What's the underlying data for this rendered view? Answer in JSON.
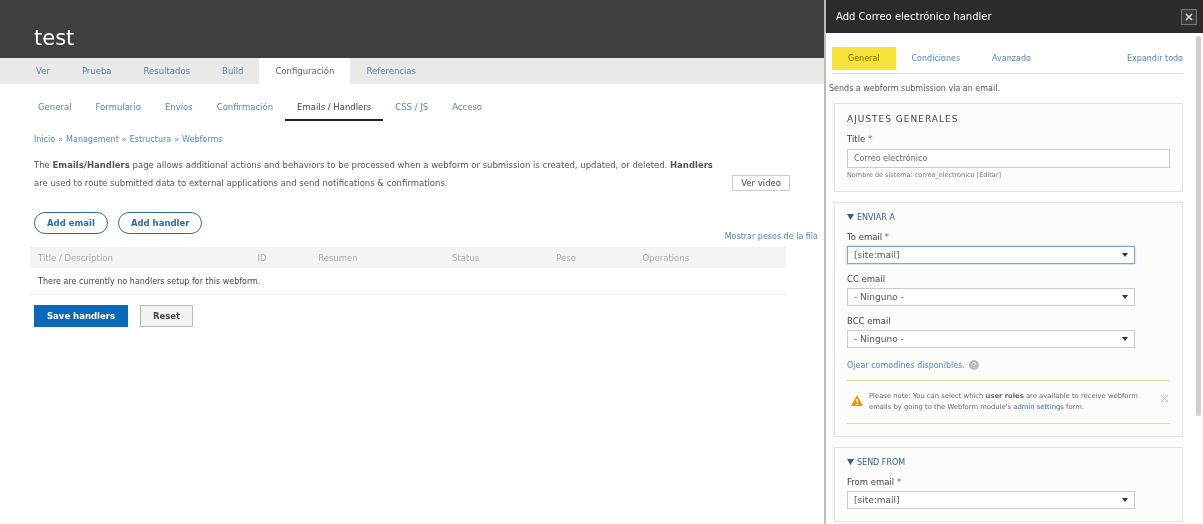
{
  "page": {
    "title": "test"
  },
  "primary_tabs": [
    {
      "label": "Ver",
      "selected": false
    },
    {
      "label": "Prueba",
      "selected": false
    },
    {
      "label": "Resultados",
      "selected": false
    },
    {
      "label": "Build",
      "selected": false
    },
    {
      "label": "Configuración",
      "selected": true
    },
    {
      "label": "Referencias",
      "selected": false
    }
  ],
  "secondary_tabs": [
    {
      "label": "General",
      "selected": false
    },
    {
      "label": "Formulario",
      "selected": false
    },
    {
      "label": "Envíos",
      "selected": false
    },
    {
      "label": "Confirmación",
      "selected": false
    },
    {
      "label": "Emails / Handlers",
      "selected": true
    },
    {
      "label": "CSS / JS",
      "selected": false
    },
    {
      "label": "Acceso",
      "selected": false
    }
  ],
  "breadcrumb": {
    "separator": "»",
    "items": [
      "Inicio",
      "Management",
      "Estructura",
      "Webforms"
    ]
  },
  "description": "The **Emails/Handlers** page allows additional actions and behaviors to be processed when a webform or submission is created, updated, or deleted. **Handlers** are used to route submitted data to external applications and send notifications & confirmations.",
  "video_button": "Ver video",
  "action_buttons": [
    "Add email",
    "Add handler"
  ],
  "weights_link": "Mostrar pesos de la fila",
  "table": {
    "columns": [
      "Title / Description",
      "ID",
      "Resumen",
      "Status",
      "Peso",
      "Operations"
    ],
    "empty_message": "There are currently no handlers setup for this webform."
  },
  "form_buttons": [
    {
      "label": "Save handlers",
      "kind": "primary"
    },
    {
      "label": "Reset",
      "kind": "secondary"
    }
  ],
  "dialog": {
    "title": "Add Correo electrónico handler",
    "tabs": [
      {
        "label": "General",
        "selected": true
      },
      {
        "label": "Condiciones",
        "selected": false
      },
      {
        "label": "Avanzado",
        "selected": false
      }
    ],
    "expand_link": "Expandir todo",
    "intro": "Sends a webform submission via an email.",
    "sections": [
      {
        "kind": "fieldset",
        "title": "AJUSTES GENERALES",
        "items": [
          {
            "kind": "text",
            "label": "Title",
            "required_mark": "*",
            "value": "Correo electrónico",
            "focused": false,
            "description": "Nombre de sistema: correo_electronico [Editar]"
          }
        ]
      },
      {
        "kind": "details",
        "title": "ENVIAR A",
        "expanded": true,
        "items": [
          {
            "kind": "select",
            "label": "To email",
            "required_mark": "*",
            "value": "[site:mail]",
            "focused": true
          },
          {
            "kind": "select",
            "label": "CC email",
            "value": "- Ninguno -",
            "focused": false
          },
          {
            "kind": "select",
            "label": "BCC email",
            "value": "- Ninguno -",
            "focused": false
          },
          {
            "kind": "link",
            "text": "Ojear comodines disponibles."
          },
          {
            "kind": "warning",
            "text": "Please note: You can select which **user roles** are available to receive webform emails by going to the Webform module's ",
            "link": "admin settings",
            "text_after": " form."
          }
        ]
      },
      {
        "kind": "details",
        "title": "SEND FROM",
        "expanded": true,
        "items": [
          {
            "kind": "select",
            "label": "From email",
            "required_mark": "*",
            "value": "[site:mail]",
            "focused": false
          }
        ]
      }
    ]
  }
}
